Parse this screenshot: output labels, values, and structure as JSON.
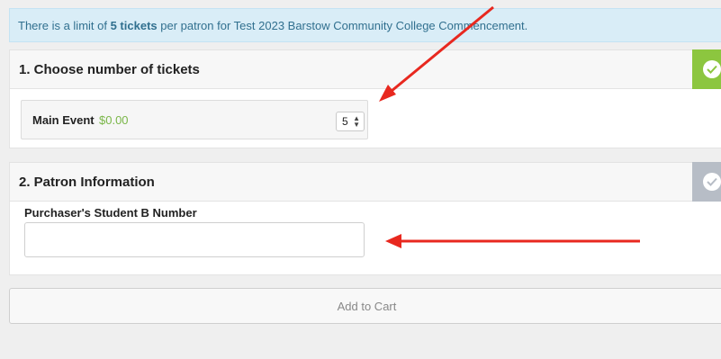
{
  "notice": {
    "prefix": "There is a limit of ",
    "limit": "5 tickets",
    "suffix": " per patron for Test 2023 Barstow Community College Commencement."
  },
  "step1": {
    "title": "1. Choose number of tickets",
    "status_icon": "check-icon",
    "ticket": {
      "name": "Main Event",
      "price": "$0.00",
      "quantity": "5"
    }
  },
  "step2": {
    "title": "2. Patron Information",
    "status_icon": "check-icon",
    "field_label": "Purchaser's Student B Number",
    "field_value": ""
  },
  "cart": {
    "button_label": "Add to Cart"
  },
  "colors": {
    "notice_bg": "#d9edf7",
    "complete_tab": "#8cc63f",
    "pending_tab": "#b7bdc6",
    "price": "#7ab648",
    "annotation_arrow": "#e8281f"
  }
}
